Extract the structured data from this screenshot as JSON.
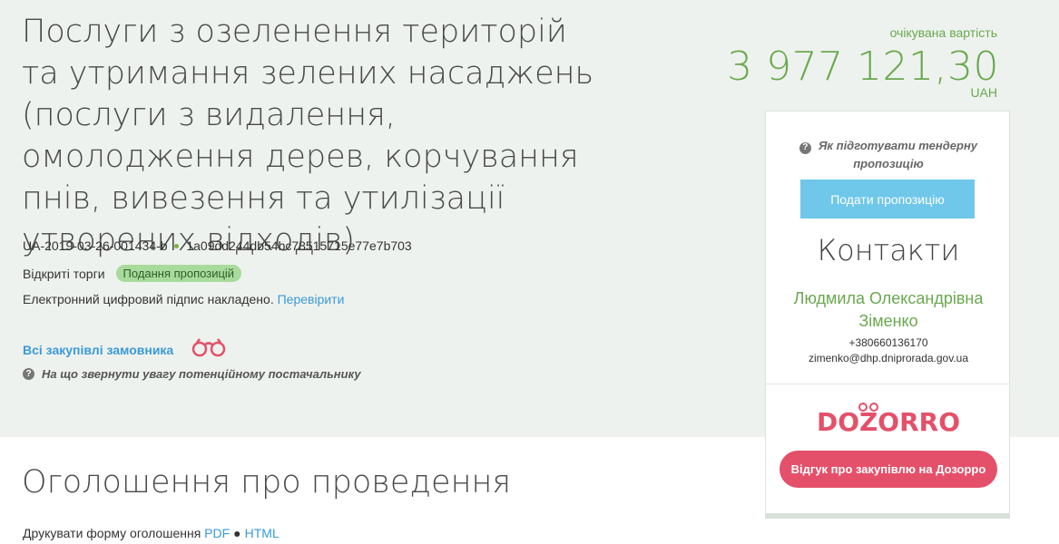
{
  "tender": {
    "title": "Послуги з озеленення територій та утримання зелених насаджень (послуги з видалення, омолодження дерев, корчування пнів, вивезення та утилізації утворених відходів)",
    "id": "UA-2019-03-26-001434-b",
    "hash": "1a09dd244db54bc78515715e77e7b703",
    "procedure": "Відкриті торги",
    "status": "Подання пропозицій",
    "signature_text": "Електронний цифровий підпис накладено.",
    "signature_link": "Перевірити",
    "buyer_link": "Всі закупівлі замовника",
    "attention_text": "На що звернути увагу потенційному постачальнику"
  },
  "cost": {
    "label": "очікувана вартість",
    "value": "3 977 121,30",
    "currency": "UAH"
  },
  "sidebar": {
    "howto": "Як підготувати тендерну пропозицію",
    "submit_button": "Подати пропозицію",
    "contacts_title": "Контакти",
    "contact_name": "Людмила Олександрівна Зіменко",
    "contact_phone": "+380660136170",
    "contact_email": "zimenko@dhp.dniprorada.gov.ua",
    "dozorro_logo": "DOZORRO",
    "dozorro_button": "Відгук про закупівлю на Дозорро"
  },
  "announcement": {
    "title": "Оголошення про проведення",
    "print_label": "Друкувати форму оголошення",
    "pdf_link": "PDF",
    "html_link": "HTML"
  },
  "colors": {
    "accent_green": "#6aa84f",
    "link_blue": "#3a9ad9",
    "submit_blue": "#6fc7ea",
    "dozorro_red": "#e4506a",
    "hero_bg": "#eef2ee"
  },
  "icons": [
    "question-icon",
    "binoculars-icon",
    "status-dot-icon"
  ]
}
